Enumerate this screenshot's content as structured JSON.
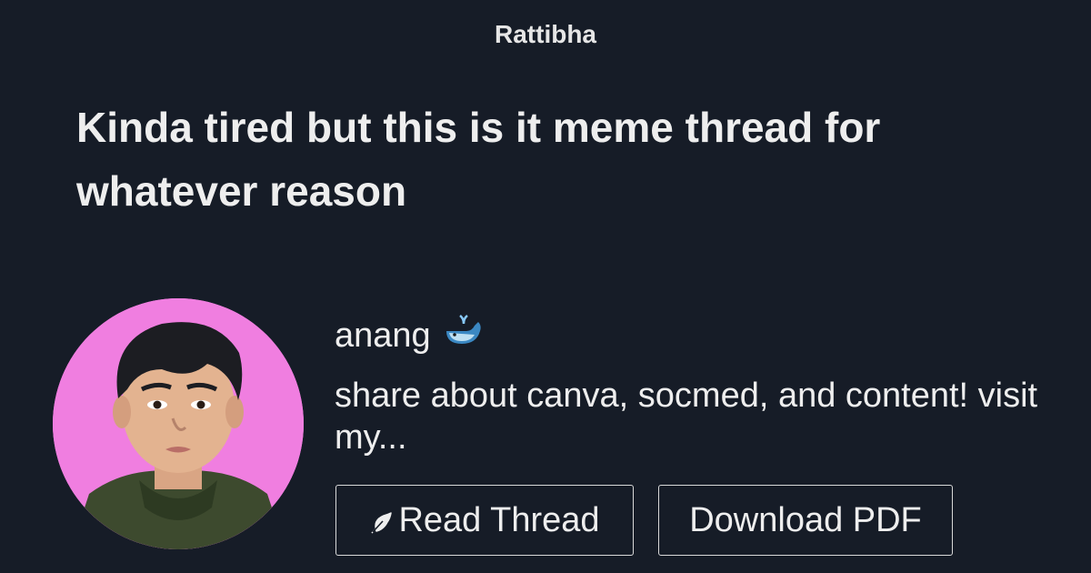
{
  "header": {
    "brand": "Rattibha"
  },
  "thread": {
    "title": "Kinda tired but this is it meme thread for whatever reason"
  },
  "author": {
    "name": "anang",
    "name_emoji": "whale-icon",
    "bio": "share about canva, socmed, and content! visit my..."
  },
  "actions": {
    "read_thread_label": "Read Thread",
    "read_thread_icon": "feather-icon",
    "download_pdf_label": "Download PDF"
  },
  "colors": {
    "background": "#161c27",
    "text": "#eeeeee",
    "avatar_background": "#f07ee0",
    "button_border": "#d8d8d8"
  }
}
